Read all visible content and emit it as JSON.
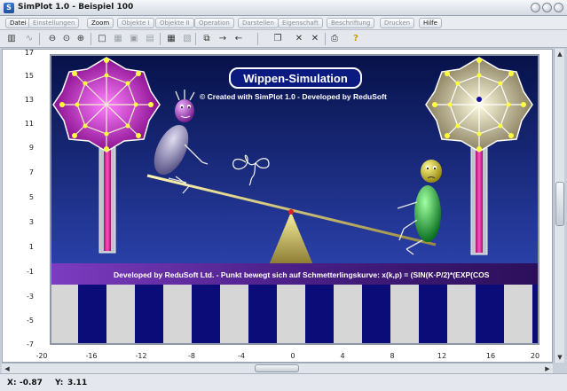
{
  "window": {
    "title": "SimPlot 1.0 - Beispiel 100",
    "icon": "app-icon"
  },
  "menu": [
    {
      "label": "Datei",
      "enabled": true
    },
    {
      "label": "Einstellungen",
      "enabled": false
    },
    {
      "label": "Zoom",
      "enabled": true
    },
    {
      "label": "Objekte I",
      "enabled": false
    },
    {
      "label": "Objekte II",
      "enabled": false
    },
    {
      "label": "Operation",
      "enabled": false
    },
    {
      "label": "Darstellen",
      "enabled": false
    },
    {
      "label": "Eigenschaft",
      "enabled": false
    },
    {
      "label": "Beschriftung",
      "enabled": false
    },
    {
      "label": "Drucken",
      "enabled": false
    },
    {
      "label": "Hilfe",
      "enabled": true
    }
  ],
  "toolbar": {
    "icons": [
      "calculator-icon",
      "graph-icon",
      "zoom-out-icon",
      "zoom-fit-icon",
      "zoom-in-icon",
      "square-icon",
      "grid-icon",
      "snap-icon",
      "points-icon",
      "table-icon",
      "chart-icon",
      "copy-icon",
      "arrow-right-icon",
      "arrow-left-icon",
      "clipboard-icon",
      "delete-icon",
      "cross-icon",
      "print-icon",
      "help-icon"
    ]
  },
  "axes": {
    "y_ticks": [
      "17",
      "15",
      "13",
      "11",
      "9",
      "7",
      "5",
      "3",
      "1",
      "-1",
      "-3",
      "-5",
      "-7"
    ],
    "x_ticks": [
      "-20",
      "-16",
      "-12",
      "-8",
      "-4",
      "0",
      "4",
      "8",
      "12",
      "16",
      "20"
    ]
  },
  "scene": {
    "title": "Wippen-Simulation",
    "copyright": "© Created with SimPlot 1.0 - Developed by ReduSoft",
    "ticker": "Developed by ReduSoft Ltd.  -  Punkt bewegt sich auf Schmetterlingskurve: x(k,p) = (SIN(K·P/2)*(EXP(COS",
    "colors": {
      "sky_top": "#0a1450",
      "sky_bottom": "#2a3fa0",
      "title_box": "#0b1a80",
      "ticker": "#5a2aa0",
      "flower_left": "#c020c0",
      "flower_right": "#a09880"
    }
  },
  "status": {
    "x_label": "X:",
    "x_value": "-0.87",
    "y_label": "Y:",
    "y_value": "3.11"
  }
}
